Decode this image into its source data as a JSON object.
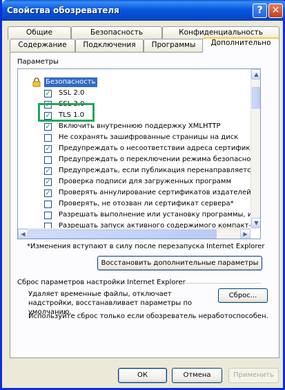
{
  "window": {
    "title": "Свойства обозревателя",
    "help_glyph": "?",
    "close_glyph": "✕"
  },
  "tabs": {
    "row1": [
      "Общие",
      "Безопасность",
      "Конфиденциальность"
    ],
    "row2": [
      "Содержание",
      "Подключения",
      "Программы",
      "Дополнительно"
    ],
    "active": "Дополнительно"
  },
  "settings": {
    "label": "Параметры",
    "group_icon": "lock-icon",
    "group_title": "Безопасность",
    "items": [
      {
        "label": "SSL 2.0",
        "checked": true
      },
      {
        "label": "SSL 3.0",
        "checked": true
      },
      {
        "label": "TLS 1.0",
        "checked": true
      },
      {
        "label": "Включить внутреннюю поддержку XMLHTTP",
        "checked": true
      },
      {
        "label": "Не сохранять зашифрованные страницы на диск",
        "checked": false
      },
      {
        "label": "Предупреждать о несоответствии адреса сертификат",
        "checked": true
      },
      {
        "label": "Предупреждать о переключении режима безопасност",
        "checked": false
      },
      {
        "label": "Предупреждать, если публикация перенаправляется",
        "checked": true
      },
      {
        "label": "Проверка подписи для загруженных программ",
        "checked": true
      },
      {
        "label": "Проверять аннулирование сертификатов издателей",
        "checked": true
      },
      {
        "label": "Проверять, не отозван ли сертификат сервера*",
        "checked": false
      },
      {
        "label": "Разрешать выполнение или установку программы, име",
        "checked": false
      },
      {
        "label": "Разрешать запуск активного содержимого компакт-ди",
        "checked": false
      }
    ],
    "note": "*Изменения вступают в силу после перезапуска Internet Explorer",
    "restore_button": "Восстановить дополнительные параметры"
  },
  "reset": {
    "group_title": "Сброс параметров настройки Internet Explorer",
    "description": "Удаляет временные файлы, отключает надстройки, восстанавливает параметры по умолчанию.",
    "button": "Сброс...",
    "warning": "Используйте сброс только если обозреватель неработоспособен."
  },
  "footer": {
    "ok": "ОК",
    "cancel": "Отмена",
    "apply": "Применить"
  },
  "highlight_color": "#22a85a"
}
